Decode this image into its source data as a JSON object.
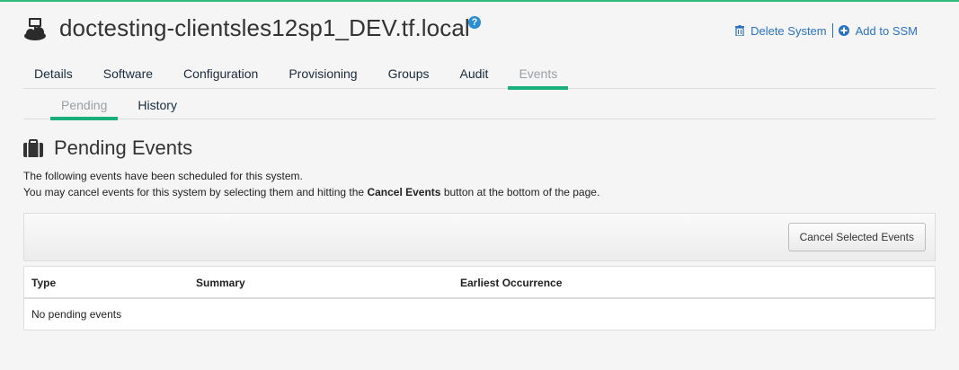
{
  "header": {
    "title": "doctesting-clientsles12sp1_DEV.tf.local",
    "help": "?",
    "delete_label": "Delete System",
    "ssm_label": "Add to SSM"
  },
  "tabs": [
    {
      "label": "Details",
      "active": false
    },
    {
      "label": "Software",
      "active": false
    },
    {
      "label": "Configuration",
      "active": false
    },
    {
      "label": "Provisioning",
      "active": false
    },
    {
      "label": "Groups",
      "active": false
    },
    {
      "label": "Audit",
      "active": false
    },
    {
      "label": "Events",
      "active": true
    }
  ],
  "subtabs": [
    {
      "label": "Pending",
      "active": true
    },
    {
      "label": "History",
      "active": false
    }
  ],
  "section": {
    "title": "Pending Events",
    "line1": "The following events have been scheduled for this system.",
    "line2_pre": "You may cancel events for this system by selecting them and hitting the ",
    "line2_bold": "Cancel Events",
    "line2_post": " button at the bottom of the page."
  },
  "toolbar": {
    "cancel_button": "Cancel Selected Events"
  },
  "table": {
    "columns": [
      "Type",
      "Summary",
      "Earliest Occurrence"
    ],
    "empty_message": "No pending events"
  },
  "colors": {
    "accent": "#1ab07c",
    "link": "#2a72c0",
    "help": "#2a8dd4"
  },
  "icons": {
    "system": "system-icon",
    "help": "help-icon",
    "delete": "trash-icon",
    "ssm": "plus-circle-icon",
    "section": "briefcase-icon"
  }
}
